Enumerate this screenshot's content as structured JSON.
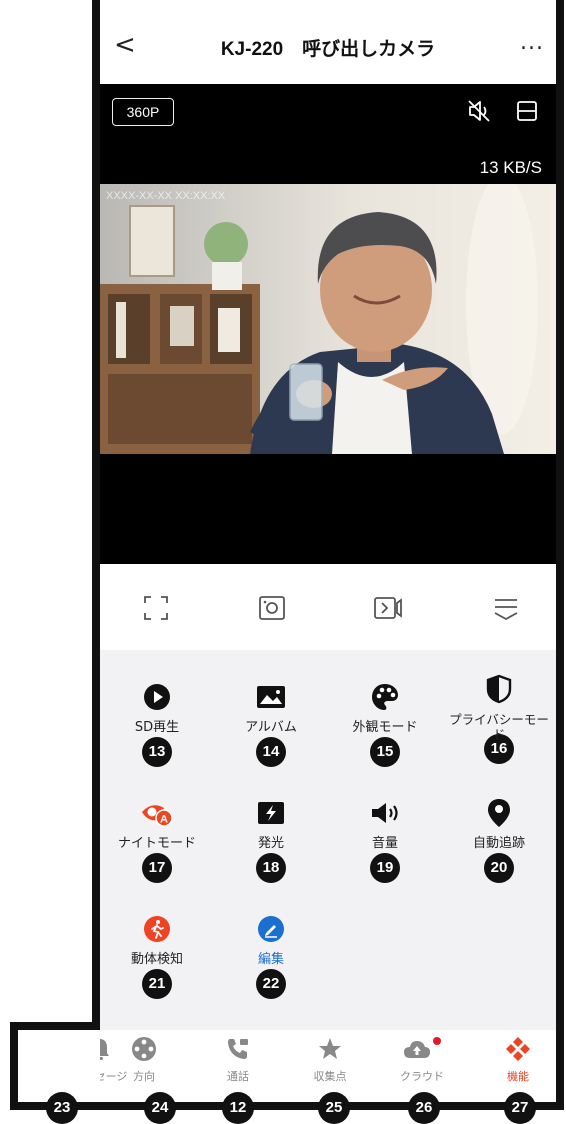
{
  "header": {
    "back_glyph": "<",
    "title": "KJ-220　呼び出しカメラ",
    "more_glyph": "..."
  },
  "video": {
    "resolution": "360P",
    "speed": "13 KB/S",
    "timestamp": "XXXX-XX-XX XX:XX:XX"
  },
  "controls": [
    "fullscreen-icon",
    "screenshot-icon",
    "record-icon",
    "collapse-icon"
  ],
  "features": [
    {
      "label": "SD再生",
      "badge": "13",
      "icon": "play-icon"
    },
    {
      "label": "アルバム",
      "badge": "14",
      "icon": "image-icon"
    },
    {
      "label": "外観モード",
      "badge": "15",
      "icon": "palette-icon"
    },
    {
      "label": "プライバシーモード",
      "badge": "16",
      "icon": "privacy-shield-icon"
    },
    {
      "label": "ナイトモード",
      "badge": "17",
      "icon": "night-eye-icon"
    },
    {
      "label": "発光",
      "badge": "18",
      "icon": "light-icon"
    },
    {
      "label": "音量",
      "badge": "19",
      "icon": "speaker-icon"
    },
    {
      "label": "自動追跡",
      "badge": "20",
      "icon": "location-pin-icon"
    },
    {
      "label": "動体検知",
      "badge": "21",
      "icon": "motion-detect-icon"
    },
    {
      "label": "編集",
      "badge": "22",
      "icon": "edit-icon"
    }
  ],
  "tabs": [
    {
      "label": "メッセージ",
      "badge": "23",
      "icon": "bell-icon"
    },
    {
      "label": "方向",
      "badge": "24",
      "icon": "direction-icon"
    },
    {
      "label": "通話",
      "badge": "12",
      "icon": "phone-icon"
    },
    {
      "label": "収集点",
      "badge": "25",
      "icon": "star-icon"
    },
    {
      "label": "クラウド",
      "badge": "26",
      "icon": "cloud-icon"
    },
    {
      "label": "機能",
      "badge": "27",
      "icon": "function-icon"
    }
  ],
  "colors": {
    "accent": "#ee4422",
    "blue": "#1a6fd1",
    "notify_dot": "#e81828"
  }
}
